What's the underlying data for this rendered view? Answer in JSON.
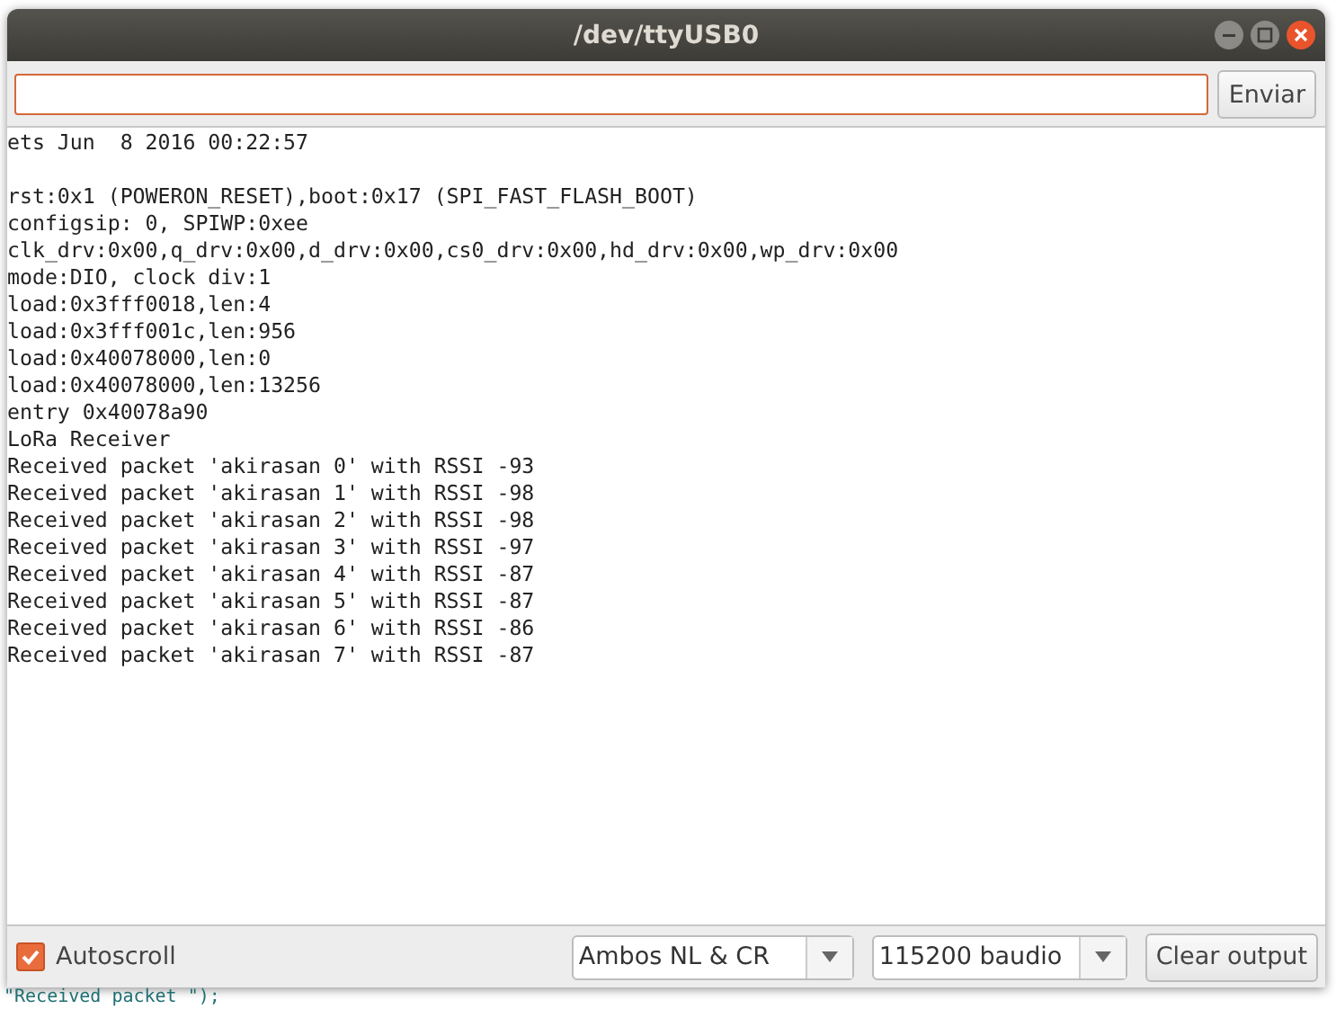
{
  "window": {
    "title": "/dev/ttyUSB0"
  },
  "send": {
    "button": "Enviar"
  },
  "output_blocks": [
    {
      "lines": [
        "ets Jun  8 2016 00:22:57"
      ]
    },
    {
      "lines": [
        "rst:0x1 (POWERON_RESET),boot:0x17 (SPI_FAST_FLASH_BOOT)",
        "configsip: 0, SPIWP:0xee",
        "clk_drv:0x00,q_drv:0x00,d_drv:0x00,cs0_drv:0x00,hd_drv:0x00,wp_drv:0x00",
        "mode:DIO, clock div:1",
        "load:0x3fff0018,len:4",
        "load:0x3fff001c,len:956",
        "load:0x40078000,len:0",
        "load:0x40078000,len:13256",
        "entry 0x40078a90",
        "LoRa Receiver",
        "Received packet 'akirasan 0' with RSSI -93",
        "Received packet 'akirasan 1' with RSSI -98",
        "Received packet 'akirasan 2' with RSSI -98",
        "Received packet 'akirasan 3' with RSSI -97",
        "Received packet 'akirasan 4' with RSSI -87",
        "Received packet 'akirasan 5' with RSSI -87",
        "Received packet 'akirasan 6' with RSSI -86",
        "Received packet 'akirasan 7' with RSSI -87"
      ]
    }
  ],
  "footer": {
    "autoscroll": {
      "label": "Autoscroll",
      "checked": true
    },
    "line_ending": "Ambos NL & CR",
    "baud": "115200 baudio",
    "clear_button": "Clear output"
  },
  "background_code": "\"Received packet \");"
}
